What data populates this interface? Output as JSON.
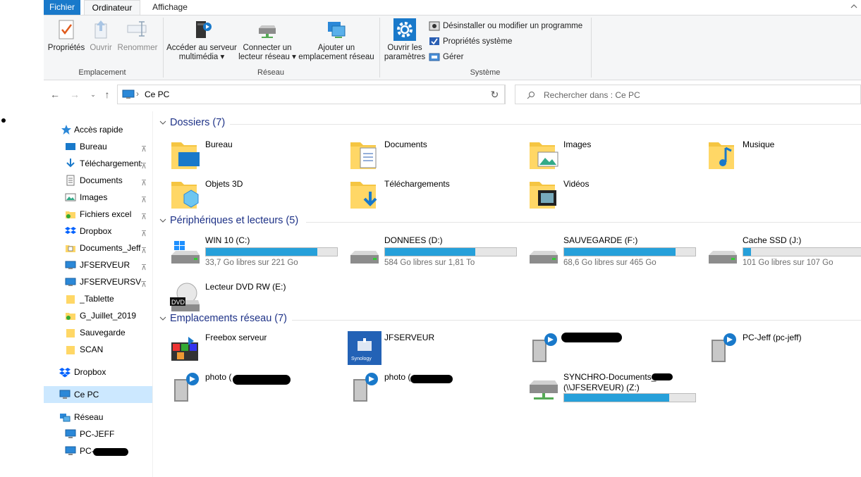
{
  "ribbon": {
    "tabs": [
      "Fichier",
      "Ordinateur",
      "Affichage"
    ],
    "emplacement": {
      "label": "Emplacement",
      "proprietes": "Propriétés",
      "ouvrir": "Ouvrir",
      "renommer": "Renommer"
    },
    "reseau": {
      "label": "Réseau",
      "acceder_l1": "Accéder au serveur",
      "acceder_l2": "multimédia ▾",
      "connecter_l1": "Connecter un",
      "connecter_l2": "lecteur réseau ▾",
      "ajouter_l1": "Ajouter un",
      "ajouter_l2": "emplacement réseau"
    },
    "systeme": {
      "label": "Système",
      "ouvrir_l1": "Ouvrir les",
      "ouvrir_l2": "paramètres",
      "desinstaller": "Désinstaller ou modifier un programme",
      "proprietes_systeme": "Propriétés système",
      "gerer": "Gérer"
    }
  },
  "address": {
    "path": "Ce PC",
    "search_placeholder": "Rechercher dans : Ce PC"
  },
  "sidebar": {
    "acces_rapide": "Accès rapide",
    "quick": [
      "Bureau",
      "Téléchargements",
      "Documents",
      "Images",
      "Fichiers excel",
      "Dropbox",
      "Documents_Jeff",
      "JFSERVEUR",
      "JFSERVEURSVG",
      "_Tablette",
      "G_Juillet_2019",
      "Sauvegarde",
      "SCAN"
    ],
    "dropbox": "Dropbox",
    "ce_pc": "Ce PC",
    "reseau": "Réseau",
    "net": [
      "PC-JEFF",
      "PC-"
    ]
  },
  "sections": {
    "dossiers": "Dossiers (7)",
    "peripheriques": "Périphériques et lecteurs (5)",
    "emplacements": "Emplacements réseau (7)"
  },
  "folders": [
    "Bureau",
    "Documents",
    "Images",
    "Musique",
    "Objets 3D",
    "Téléchargements",
    "Vidéos"
  ],
  "drives": [
    {
      "name": "WIN 10 (C:)",
      "free": "33,7 Go libres sur 221 Go",
      "used": 0.85
    },
    {
      "name": "DONNEES (D:)",
      "free": "584 Go libres sur 1,81 To",
      "used": 0.69
    },
    {
      "name": "SAUVEGARDE (F:)",
      "free": "68,6 Go libres sur 465 Go",
      "used": 0.85
    },
    {
      "name": "Cache SSD (J:)",
      "free": "101 Go libres sur 107 Go",
      "used": 0.06
    },
    {
      "name": "Lecteur DVD RW (E:)"
    }
  ],
  "network": {
    "freebox": "Freebox serveur",
    "jfserveur": "JFSERVEUR",
    "pc_jeff": "PC-Jeff (pc-jeff)",
    "photo1": "photo (",
    "photo2": "photo (",
    "synchro_l1": "SYNCHRO-Documents_",
    "synchro_l2": "(\\\\JFSERVEUR) (Z:)",
    "synchro_used": 0.8,
    "dvd_badge": "DVD",
    "synology": "Synology"
  },
  "colors": {
    "accent": "#1979ca",
    "bar": "#26a0da",
    "header": "#1e3287",
    "selected": "#cce8ff"
  }
}
